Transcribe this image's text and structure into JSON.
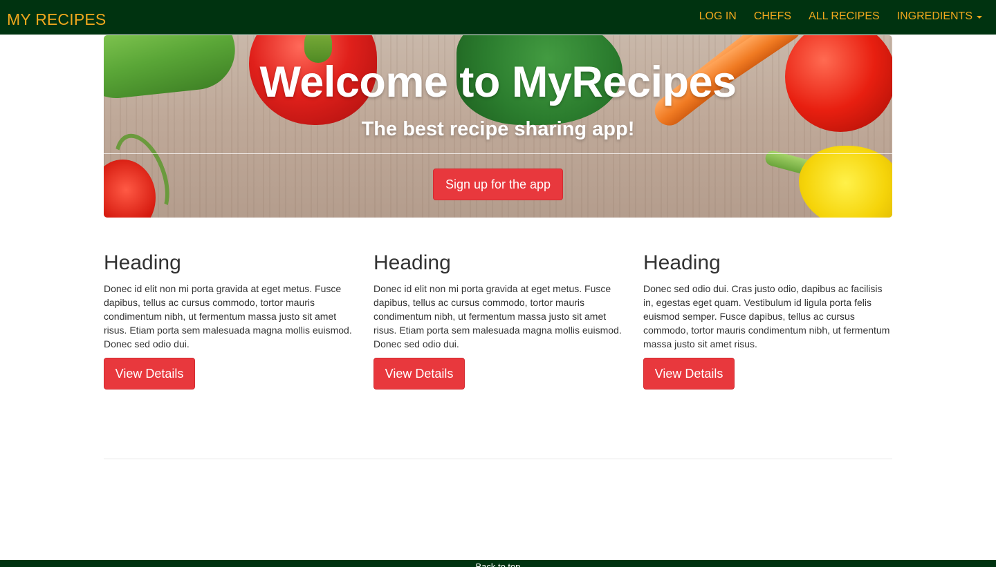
{
  "navbar": {
    "brand": "MY RECIPES",
    "links": [
      {
        "label": "LOG IN"
      },
      {
        "label": "CHEFS"
      },
      {
        "label": "ALL RECIPES"
      },
      {
        "label": "INGREDIENTS"
      }
    ]
  },
  "hero": {
    "title": "Welcome to MyRecipes",
    "subtitle": "The best recipe sharing app!",
    "cta_label": "Sign up for the app"
  },
  "columns": [
    {
      "heading": "Heading",
      "body": "Donec id elit non mi porta gravida at eget metus. Fusce dapibus, tellus ac cursus commodo, tortor mauris condimentum nibh, ut fermentum massa justo sit amet risus. Etiam porta sem malesuada magna mollis euismod. Donec sed odio dui.",
      "button_label": "View Details"
    },
    {
      "heading": "Heading",
      "body": "Donec id elit non mi porta gravida at eget metus. Fusce dapibus, tellus ac cursus commodo, tortor mauris condimentum nibh, ut fermentum massa justo sit amet risus. Etiam porta sem malesuada magna mollis euismod. Donec sed odio dui.",
      "button_label": "View Details"
    },
    {
      "heading": "Heading",
      "body": "Donec sed odio dui. Cras justo odio, dapibus ac facilisis in, egestas eget quam. Vestibulum id ligula porta felis euismod semper. Fusce dapibus, tellus ac cursus commodo, tortor mauris condimentum nibh, ut fermentum massa justo sit amet risus.",
      "button_label": "View Details"
    }
  ],
  "footer": {
    "back_to_top": "Back to top"
  },
  "colors": {
    "navbar_bg": "#003310",
    "nav_text": "#f0a81e",
    "button_red": "#e8383d"
  },
  "icons": {
    "dropdown": "caret-down-icon"
  }
}
